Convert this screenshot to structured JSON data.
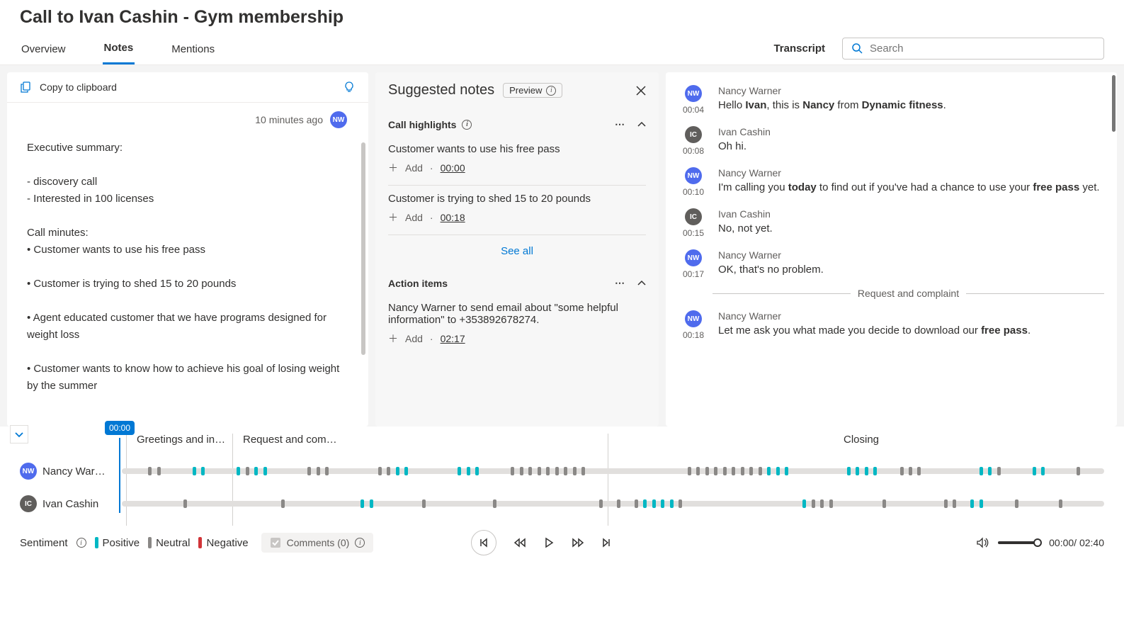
{
  "page_title": "Call to Ivan Cashin - Gym membership",
  "tabs": {
    "overview": "Overview",
    "notes": "Notes",
    "mentions": "Mentions",
    "active": "Notes"
  },
  "transcript_label": "Transcript",
  "search": {
    "placeholder": "Search"
  },
  "notes_panel": {
    "copy_label": "Copy to clipboard",
    "meta_time": "10 minutes ago",
    "meta_initials": "NW",
    "body": "Executive summary:\n\n- discovery call\n- Interested in 100 licenses\n\nCall minutes:\n• Customer wants to use his free pass\n\n• Customer is trying to shed 15 to 20 pounds\n\n• Agent educated customer that we have programs designed for weight loss\n\n• Customer wants to know how to achieve his goal of losing weight by the summer"
  },
  "suggested": {
    "title": "Suggested notes",
    "preview": "Preview",
    "sections": {
      "highlights": {
        "title": "Call highlights",
        "items": [
          {
            "text": "Customer wants to use his free pass",
            "time": "00:00"
          },
          {
            "text": "Customer is trying to shed 15 to 20 pounds",
            "time": "00:18"
          }
        ],
        "see_all": "See all"
      },
      "actions": {
        "title": "Action items",
        "items": [
          {
            "text": "Nancy Warner to send email about \"some helpful information\" to +353892678274.",
            "time": "02:17"
          }
        ]
      }
    },
    "add_label": "Add"
  },
  "transcript": {
    "messages": [
      {
        "initials": "NW",
        "av": "nw",
        "speaker": "Nancy Warner",
        "time": "00:04",
        "html": "Hello <b>Ivan</b>, this is <b>Nancy</b> from <b>Dynamic fitness</b>."
      },
      {
        "initials": "IC",
        "av": "ic",
        "speaker": "Ivan Cashin",
        "time": "00:08",
        "html": "Oh hi."
      },
      {
        "initials": "NW",
        "av": "nw",
        "speaker": "Nancy Warner",
        "time": "00:10",
        "html": "I'm calling you <b>today</b> to find out if you've had a chance to use your <b>free pass</b> yet."
      },
      {
        "initials": "IC",
        "av": "ic",
        "speaker": "Ivan Cashin",
        "time": "00:15",
        "html": "No, not yet."
      },
      {
        "initials": "NW",
        "av": "nw",
        "speaker": "Nancy Warner",
        "time": "00:17",
        "html": "OK, that's no problem."
      }
    ],
    "divider": "Request and complaint",
    "messages2": [
      {
        "initials": "NW",
        "av": "nw",
        "speaker": "Nancy Warner",
        "time": "00:18",
        "html": "Let me ask you what made you decide to download our <b>free pass</b>."
      }
    ]
  },
  "timeline": {
    "playhead": "00:00",
    "segments": [
      "Greetings and in…",
      "Request and com…",
      "Closing"
    ],
    "speakers": [
      {
        "initials": "NW",
        "av": "nw",
        "name": "Nancy War…"
      },
      {
        "initials": "IC",
        "av": "ic",
        "name": "Ivan Cashin"
      }
    ]
  },
  "controls": {
    "sentiment_label": "Sentiment",
    "legend": {
      "pos": "Positive",
      "neu": "Neutral",
      "neg": "Negative"
    },
    "comments_label": "Comments (0)",
    "time_current": "00:00",
    "time_total": "02:40"
  }
}
